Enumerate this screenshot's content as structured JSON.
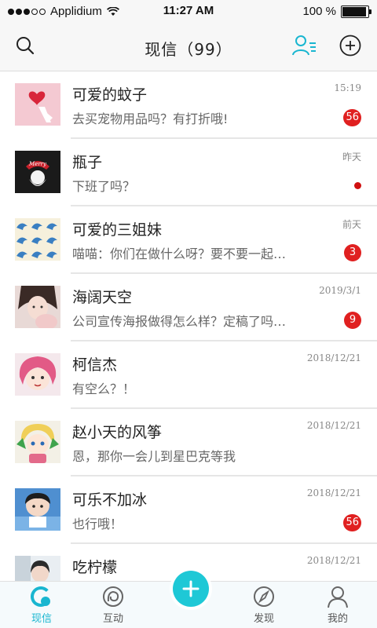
{
  "statusbar": {
    "carrier": "Applidium",
    "time": "11:27 AM",
    "battery": "100 %",
    "battery_level": 1.0
  },
  "header": {
    "title": "现信（99）"
  },
  "conversations": [
    {
      "name": "可爱的蚊子",
      "message": "去买宠物用品吗？有打折哦!",
      "time": "15:19",
      "badge": "56"
    },
    {
      "name": "瓶子",
      "message": "下班了吗？",
      "time": "昨天",
      "unread_dot": true
    },
    {
      "name": "可爱的三姐妹",
      "message": "喵喵：你们在做什么呀？要不要一起…",
      "time": "前天",
      "badge": "3"
    },
    {
      "name": "海阔天空",
      "message": "公司宣传海报做得怎么样？定稿了吗…",
      "time": "2019/3/1",
      "badge": "9"
    },
    {
      "name": "柯信杰",
      "message": "有空么？！",
      "time": "2018/12/21"
    },
    {
      "name": "赵小天的风筝",
      "message": "恩，那你一会儿到星巴克等我",
      "time": "2018/12/21"
    },
    {
      "name": "可乐不加冰",
      "message": "也行哦！",
      "time": "2018/12/21",
      "badge": "56"
    },
    {
      "name": "吃柠檬",
      "message": "",
      "time": "2018/12/21"
    }
  ],
  "tabs": [
    {
      "label": "现信",
      "icon": "chat-bubble-icon",
      "active": true
    },
    {
      "label": "互动",
      "icon": "interact-icon",
      "active": false
    },
    {
      "label": "发现",
      "icon": "compass-icon",
      "active": false
    },
    {
      "label": "我的",
      "icon": "profile-icon",
      "active": false
    }
  ],
  "colors": {
    "accent": "#19b6d0",
    "badge": "#e02020",
    "fab": "#1ec8d6"
  }
}
